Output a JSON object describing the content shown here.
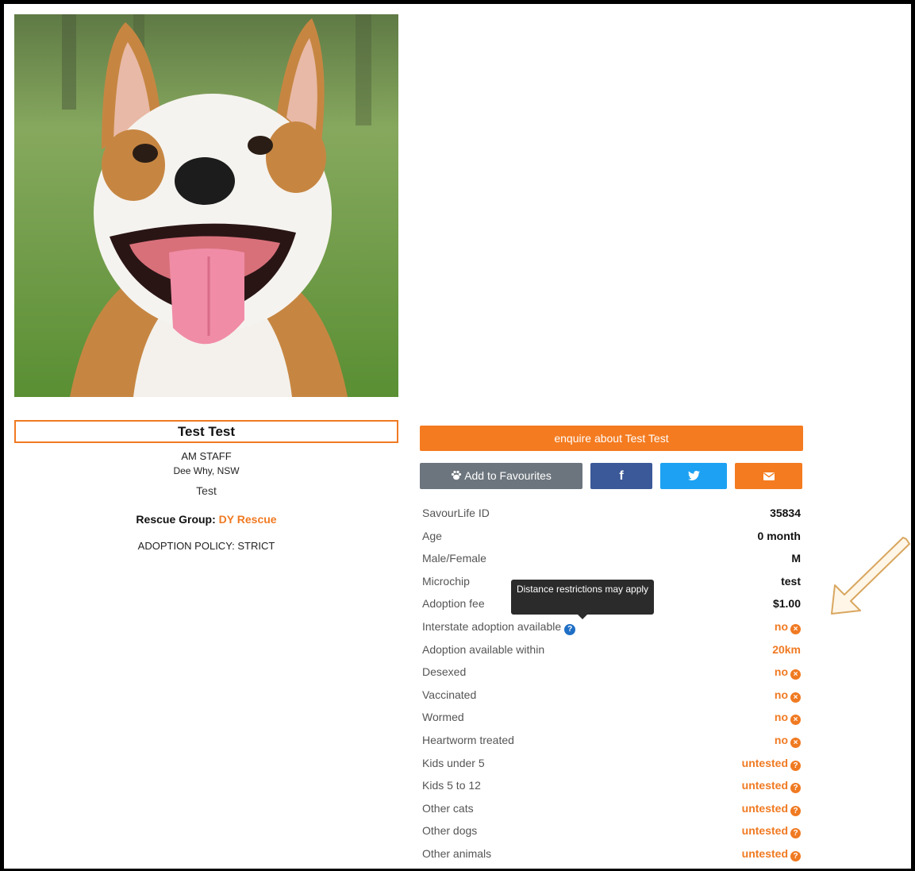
{
  "pet": {
    "name": "Test Test",
    "breed": "AM STAFF",
    "location": "Dee Why, NSW",
    "description": "Test",
    "rescue_label": "Rescue Group:",
    "rescue_name": "DY Rescue",
    "policy": "ADOPTION POLICY: STRICT"
  },
  "actions": {
    "enquire": "enquire about Test Test",
    "favourites": "Add to Favourites",
    "facebook_icon": "f"
  },
  "tooltip": "Distance restrictions may apply",
  "details": [
    {
      "label": "SavourLife ID",
      "value": "35834"
    },
    {
      "label": "Age",
      "value": "0 month"
    },
    {
      "label": "Male/Female",
      "value": "M"
    },
    {
      "label": "Microchip",
      "value": "test"
    },
    {
      "label": "Adoption fee",
      "value": "$1.00"
    },
    {
      "label": "Interstate adoption available",
      "value": "no"
    },
    {
      "label": "Adoption available within",
      "value": "20km"
    },
    {
      "label": "Desexed",
      "value": "no"
    },
    {
      "label": "Vaccinated",
      "value": "no"
    },
    {
      "label": "Wormed",
      "value": "no"
    },
    {
      "label": "Heartworm treated",
      "value": "no"
    },
    {
      "label": "Kids under 5",
      "value": "untested"
    },
    {
      "label": "Kids 5 to 12",
      "value": "untested"
    },
    {
      "label": "Other cats",
      "value": "untested"
    },
    {
      "label": "Other dogs",
      "value": "untested"
    },
    {
      "label": "Other animals",
      "value": "untested"
    }
  ],
  "colors": {
    "accent": "#f47b20",
    "facebook": "#3b5998",
    "twitter": "#1da1f2",
    "grey_button": "#6c757d"
  }
}
